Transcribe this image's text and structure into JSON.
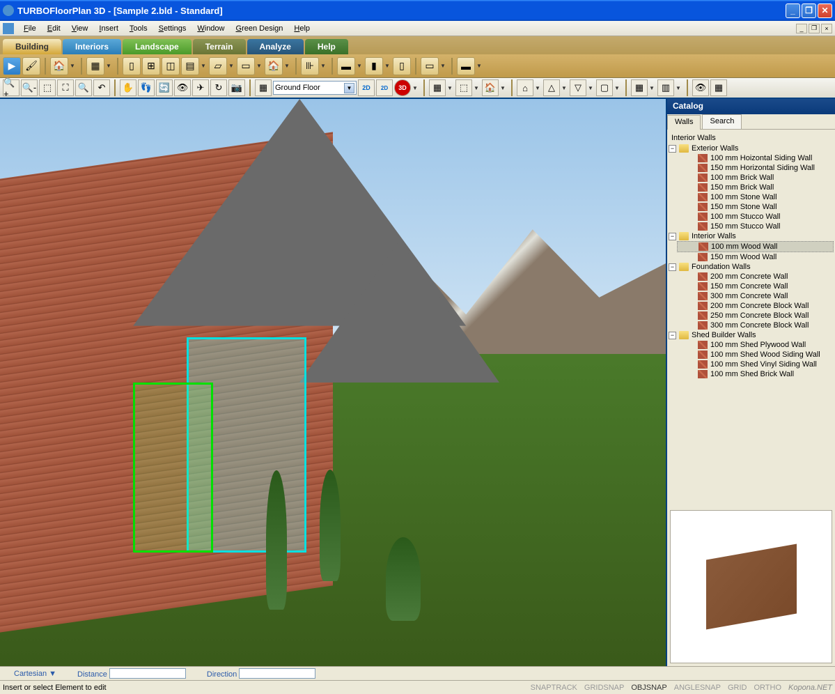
{
  "title": "TURBOFloorPlan 3D - [Sample 2.bld - Standard]",
  "menus": [
    "File",
    "Edit",
    "View",
    "Insert",
    "Tools",
    "Settings",
    "Window",
    "Green Design",
    "Help"
  ],
  "ribbon_tabs": [
    {
      "label": "Building",
      "cls": "active"
    },
    {
      "label": "Interiors",
      "cls": "interiors"
    },
    {
      "label": "Landscape",
      "cls": "landscape"
    },
    {
      "label": "Terrain",
      "cls": "terrain"
    },
    {
      "label": "Analyze",
      "cls": "analyze"
    },
    {
      "label": "Help",
      "cls": "help"
    }
  ],
  "floor_selector": "Ground Floor",
  "catalog": {
    "title": "Catalog",
    "tabs": [
      "Walls",
      "Search"
    ],
    "root_label": "Interior Walls",
    "groups": [
      {
        "name": "Exterior Walls",
        "items": [
          "100 mm Hoizontal Siding Wall",
          "150 mm Horizontal Siding Wall",
          "100 mm Brick Wall",
          "150 mm Brick Wall",
          "100 mm Stone Wall",
          "150 mm Stone Wall",
          "100 mm Stucco Wall",
          "150 mm Stucco Wall"
        ]
      },
      {
        "name": "Interior Walls",
        "items": [
          "100 mm Wood Wall",
          "150 mm Wood Wall"
        ],
        "selected": "100 mm Wood Wall"
      },
      {
        "name": "Foundation Walls",
        "items": [
          "200 mm Concrete Wall",
          "150 mm Concrete Wall",
          "300 mm Concrete Wall",
          "200 mm Concrete Block Wall",
          "250 mm Concrete Block Wall",
          "300 mm Concrete Block Wall"
        ]
      },
      {
        "name": "Shed Builder Walls",
        "items": [
          "100 mm Shed Plywood Wall",
          "100 mm Shed Wood Siding Wall",
          "100 mm Shed Vinyl Siding Wall",
          "100 mm Shed Brick Wall"
        ]
      }
    ]
  },
  "measure": {
    "coord": "Cartesian ▼",
    "dist": "Distance",
    "dir": "Direction"
  },
  "status": {
    "hint": "Insert or select Element to edit",
    "snaps": [
      "SNAPTRACK",
      "GRIDSNAP",
      "OBJSNAP",
      "ANGLESNAP",
      "GRID",
      "ORTHO"
    ],
    "watermark": "Kopona.NET"
  }
}
